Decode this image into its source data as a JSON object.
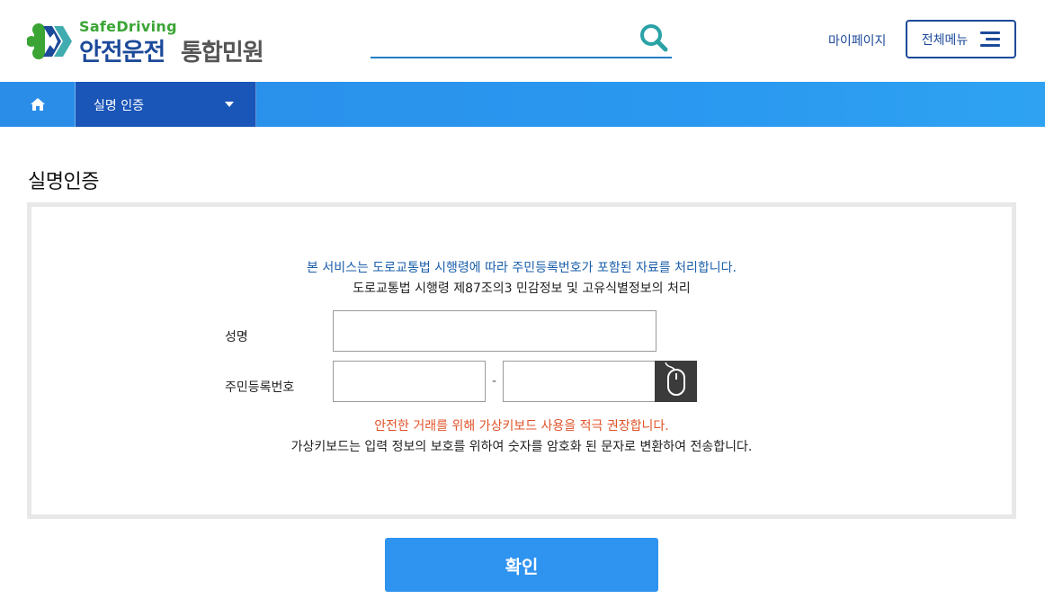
{
  "header": {
    "logo_en": "SafeDriving",
    "logo_ko_main": "안전운전",
    "logo_ko_sub": "통합민원",
    "search_value": "",
    "mypage_label": "마이페이지",
    "allmenu_label": "전체메뉴",
    "brand_colors": {
      "navy": "#1c4a9a",
      "green": "#3aa535",
      "teal": "#2ba3a6"
    }
  },
  "nav": {
    "home_icon": "home-icon",
    "dropdown_label": "실명 인증",
    "bar_color": "#2a8de8",
    "active_color": "#1a55b8"
  },
  "main": {
    "title": "실명인증",
    "notice_line1": "본 서비스는 도로교통법 시행령에 따라 주민등록번호가 포함된 자료를 처리합니다.",
    "notice_line2": "도로교통법 시행령 제87조의3 민감정보 및 고유식별정보의 처리",
    "name_label": "성명",
    "name_value": "",
    "rrn_label": "주민등록번호",
    "rrn_front_value": "",
    "rrn_back_value": "",
    "rrn_separator": "-",
    "virtual_keyboard_icon": "mouse-icon",
    "warning": "안전한 거래를 위해 가상키보드 사용을 적극 권장합니다.",
    "info": "가상키보드는 입력 정보의 보호를 위하여 숫자를 암호화 된 문자로 변환하여 전송합니다.",
    "confirm_label": "확인",
    "warning_color": "#e0532a",
    "notice_color": "#1a5eaa"
  }
}
